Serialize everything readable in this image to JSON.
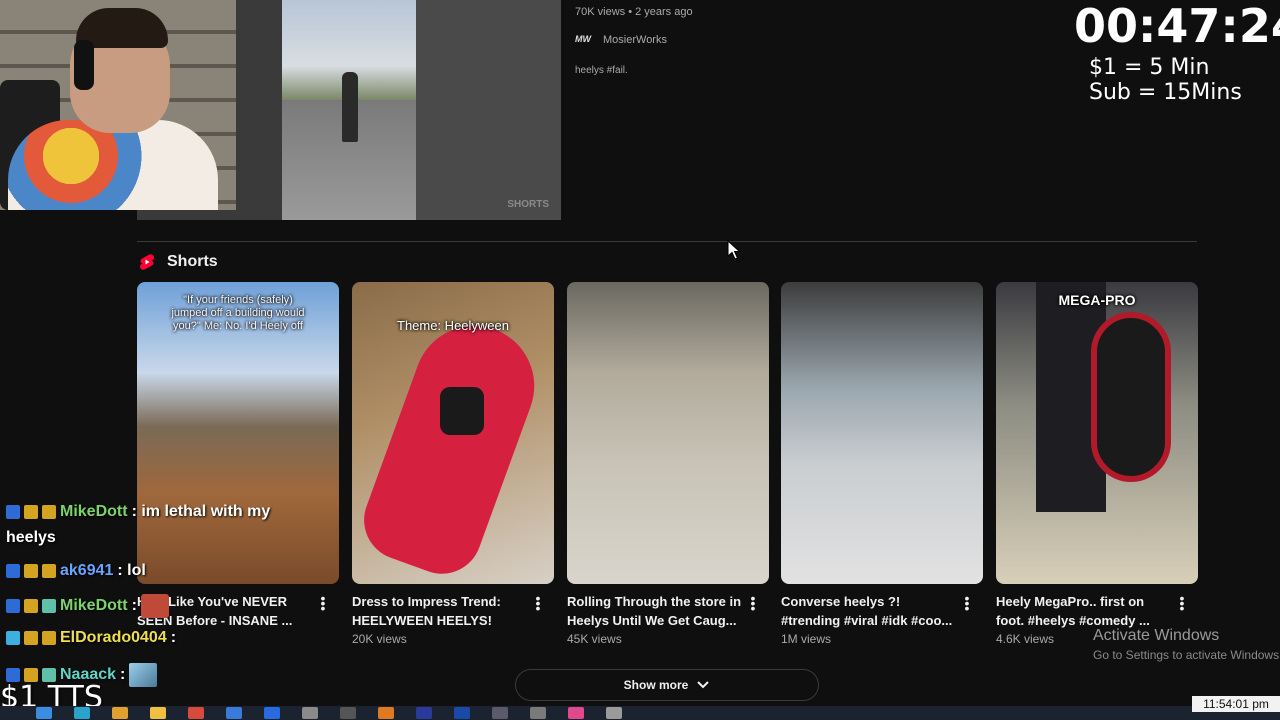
{
  "top_video": {
    "views": "70K views • 2 years ago",
    "channel_logo": "MW",
    "channel": "MosierWorks",
    "description": "heelys #fail.",
    "thumb_badge": "SHORTS"
  },
  "overlay": {
    "timer": "00:47:24",
    "rate_dollar": "$1 = 5 Min",
    "rate_sub": "Sub = 15Mins",
    "tts": "$1 TTS"
  },
  "shorts": {
    "section_title": "Shorts",
    "cards": [
      {
        "overlay_text": "\"If your friends (safely) jumped off a building would you?\" Me: No. I'd Heely off",
        "title_line1": "He... Like You've NEVER",
        "title_line2": "SEEN Before - INSANE ...",
        "views": ""
      },
      {
        "overlay_text": "Theme: Heelyween",
        "title_line1": "Dress to Impress Trend:",
        "title_line2": "HEELYWEEN HEELYS!",
        "views": "20K views"
      },
      {
        "overlay_text": "",
        "title_line1": "Rolling Through the store in",
        "title_line2": "Heelys Until We Get Caug...",
        "views": "45K views"
      },
      {
        "overlay_text": "",
        "title_line1": "Converse heelys ?!",
        "title_line2": "#trending #viral #idk #coo...",
        "views": "1M views"
      },
      {
        "overlay_text": "MEGA-PRO",
        "title_line1": "Heely MegaPro.. first on",
        "title_line2": "foot. #heelys #comedy ...",
        "views": "4.6K views"
      }
    ],
    "show_more": "Show more"
  },
  "chat": [
    {
      "user": "MikeDott",
      "message": ": im lethal with my",
      "continuation": "heelys"
    },
    {
      "user": "ak6941",
      "message": ": lol"
    },
    {
      "user": "MikeDott",
      "message": ":"
    },
    {
      "user": "ElDorado0404",
      "message": ":"
    },
    {
      "user": "Naaack",
      "message": ":"
    }
  ],
  "windows": {
    "activate_title": "Activate Windows",
    "activate_sub": "Go to Settings to activate Windows.",
    "clock": "11:54:01 pm"
  },
  "colors": {
    "background": "#0f0f0f",
    "shorts_red": "#ff0033",
    "text_primary": "#f1f1f1",
    "text_secondary": "#aaaaaa"
  }
}
